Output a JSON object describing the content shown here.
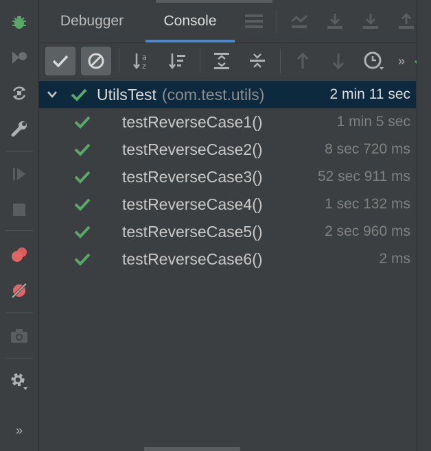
{
  "tabs": [
    {
      "label": "Debugger"
    },
    {
      "label": "Console"
    }
  ],
  "tree": {
    "root": {
      "name": "UtilsTest",
      "package": "(com.test.utils)",
      "duration": "2 min 11 sec"
    },
    "tests": [
      {
        "name": "testReverseCase1()",
        "duration": "1 min 5 sec"
      },
      {
        "name": "testReverseCase2()",
        "duration": "8 sec 720 ms"
      },
      {
        "name": "testReverseCase3()",
        "duration": "52 sec 911 ms"
      },
      {
        "name": "testReverseCase4()",
        "duration": "1 sec 132 ms"
      },
      {
        "name": "testReverseCase5()",
        "duration": "2 sec 960 ms"
      },
      {
        "name": "testReverseCase6()",
        "duration": "2 ms"
      }
    ]
  },
  "toolbar": {
    "overflow": "»"
  },
  "sidebar": {
    "overflow": "»"
  },
  "colors": {
    "pass": "#59a869",
    "selection": "#0d293e",
    "accent": "#4a88c7"
  }
}
